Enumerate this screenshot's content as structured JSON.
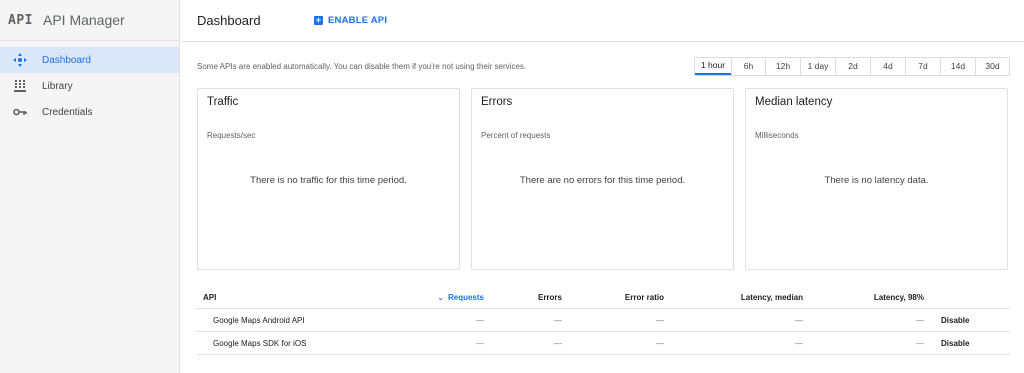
{
  "sidebar": {
    "logo": "API",
    "title": "API Manager",
    "items": [
      {
        "label": "Dashboard",
        "icon": "dashboard-icon",
        "active": true
      },
      {
        "label": "Library",
        "icon": "library-icon",
        "active": false
      },
      {
        "label": "Credentials",
        "icon": "key-icon",
        "active": false
      }
    ]
  },
  "header": {
    "title": "Dashboard",
    "enable_api": "ENABLE API"
  },
  "info": "Some APIs are enabled automatically. You can disable them if you're not using their services.",
  "time_ranges": [
    "1 hour",
    "6h",
    "12h",
    "1 day",
    "2d",
    "4d",
    "7d",
    "14d",
    "30d"
  ],
  "selected_range": "1 hour",
  "cards": [
    {
      "title": "Traffic",
      "subtitle": "Requests/sec",
      "empty": "There is no traffic for this time period."
    },
    {
      "title": "Errors",
      "subtitle": "Percent of requests",
      "empty": "There are no errors for this time period."
    },
    {
      "title": "Median latency",
      "subtitle": "Milliseconds",
      "empty": "There is no latency data."
    }
  ],
  "table": {
    "columns": [
      "API",
      "Requests",
      "Errors",
      "Error ratio",
      "Latency, median",
      "Latency, 98%"
    ],
    "rows": [
      {
        "api": "Google Maps Android API",
        "requests": "—",
        "errors": "—",
        "ratio": "—",
        "lat_median": "—",
        "lat_98": "—",
        "action": "Disable"
      },
      {
        "api": "Google Maps SDK for iOS",
        "requests": "—",
        "errors": "—",
        "ratio": "—",
        "lat_median": "—",
        "lat_98": "—",
        "action": "Disable"
      }
    ]
  },
  "colors": {
    "accent": "#1a73e8",
    "sidebar_bg": "#f5f5f5",
    "active_bg": "#dbe6f8"
  }
}
